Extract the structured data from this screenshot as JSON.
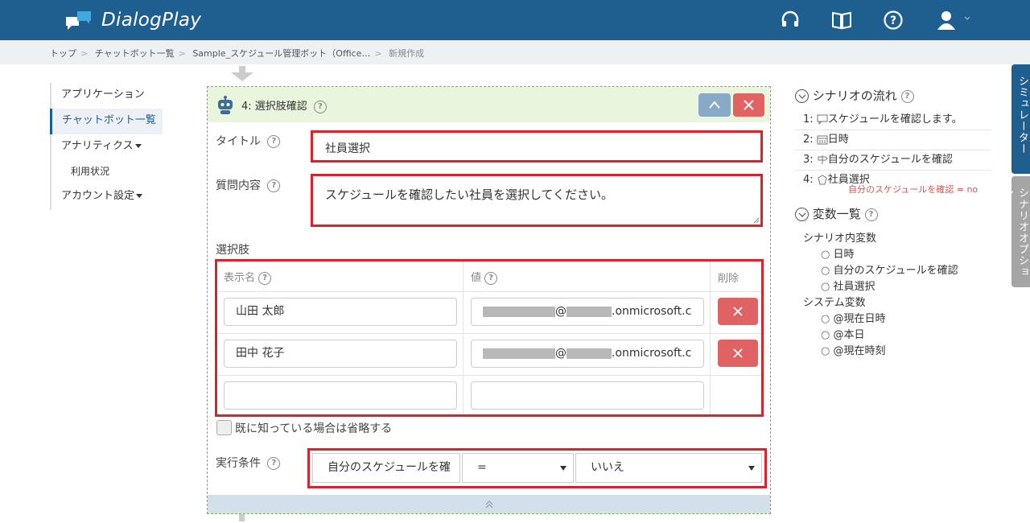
{
  "app": {
    "title": "DialogPlay"
  },
  "breadcrumb": [
    "トップ",
    "チャットボット一覧",
    "Sample_スケジュール管理ボット（Office…",
    "新規作成"
  ],
  "sidebar": {
    "items": [
      {
        "label": "アプリケーション"
      },
      {
        "label": "チャットボット一覧"
      },
      {
        "label": "アナリティクス"
      },
      {
        "label": "利用状況"
      },
      {
        "label": "アカウント設定"
      }
    ]
  },
  "step": {
    "header": "4: 選択肢確認",
    "title_label": "タイトル",
    "title_value": "社員選択",
    "question_label": "質問内容",
    "question_value": "スケジュールを確認したい社員を選択してください。",
    "choices_label": "選択肢",
    "columns": {
      "name": "表示名",
      "value": "値",
      "delete": "削除"
    },
    "rows": [
      {
        "name": "山田 太郎",
        "at": "@",
        "domain": ".onmicrosoft.c"
      },
      {
        "name": "田中 花子",
        "at": "@",
        "domain": ".onmicrosoft.c"
      }
    ],
    "skip_label": "既に知っている場合は省略する",
    "condition_label": "実行条件",
    "condition": {
      "variable": "自分のスケジュールを確",
      "operator": "=",
      "value": "いいえ"
    }
  },
  "right": {
    "flow_title": "シナリオの流れ",
    "flow": [
      {
        "num": "1:",
        "text": "スケジュールを確認します。"
      },
      {
        "num": "2:",
        "text": "日時"
      },
      {
        "num": "3:",
        "text": "自分のスケジュールを確認"
      },
      {
        "num": "4:",
        "text": "社員選択",
        "sub": "自分のスケジュールを確認 = no"
      }
    ],
    "vars_title": "変数一覧",
    "scenario_vars_label": "シナリオ内変数",
    "scenario_vars": [
      "日時",
      "自分のスケジュールを確認",
      "社員選択"
    ],
    "system_vars_label": "システム変数",
    "system_vars": [
      "@現在日時",
      "@本日",
      "@現在時刻"
    ]
  },
  "tabs": {
    "simulator": "シミュレーター",
    "options": "シナリオオプション"
  },
  "colors": {
    "header": "#1f5f8f",
    "danger": "#e06262",
    "highlight": "#d8222c"
  }
}
